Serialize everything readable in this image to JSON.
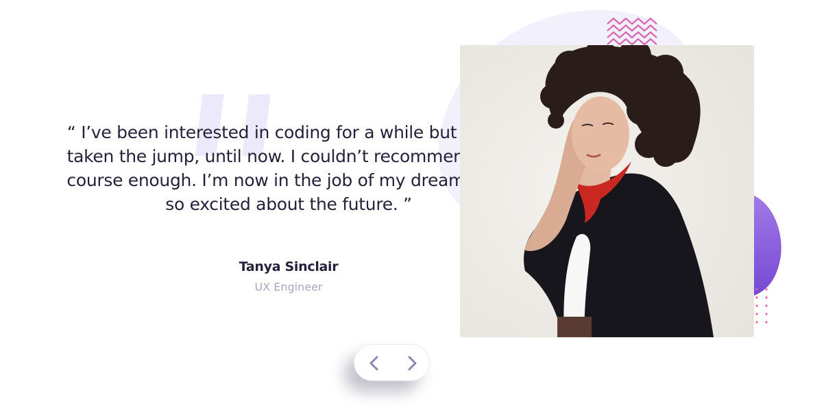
{
  "testimonial": {
    "quote": "“ I’ve been interested in coding for a while but never taken the jump, until now. I couldn’t recommend this course enough. I’m now in the job of my dreams and so excited about the future. ”",
    "author_name": "Tanya Sinclair",
    "author_role": "UX Engineer"
  },
  "navigation": {
    "prev_icon": "chevron-left-icon",
    "next_icon": "chevron-right-icon"
  },
  "colors": {
    "text_dark": "#25213b",
    "text_muted": "#a9a6c0",
    "accent_purple": "#8a5fd9",
    "accent_pink": "#d864b2",
    "quote_mark": "#eceafa",
    "nav_icon": "#8a86b5"
  },
  "icons": {
    "quote_mark": "quote-mark-icon",
    "zigzag": "zigzag-pattern-icon",
    "dots": "dot-grid-icon"
  }
}
